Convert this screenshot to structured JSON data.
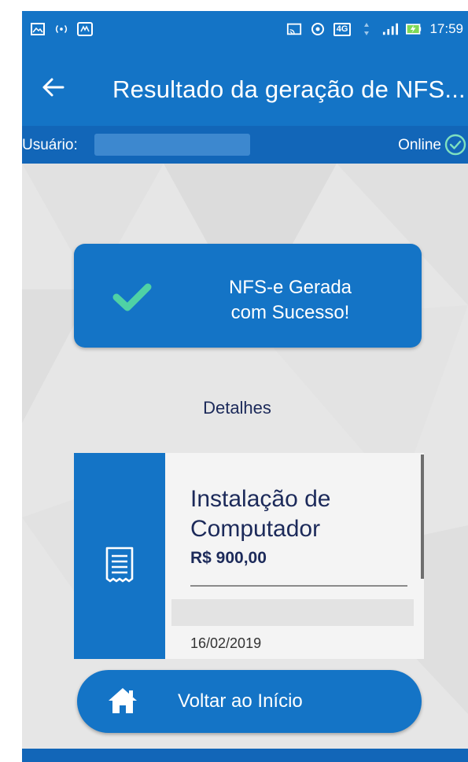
{
  "status_bar": {
    "left_icons": [
      "image-icon",
      "hotspot-icon",
      "app-icon"
    ],
    "right_icons": [
      "cast-icon",
      "nfc-icon",
      "network-4g-icon",
      "data-arrows-icon",
      "signal-icon",
      "battery-charging-icon"
    ],
    "network_label": "4G",
    "time": "17:59"
  },
  "app_bar": {
    "back_icon": "arrow-left-icon",
    "title": "Resultado da geração de NFS..."
  },
  "user_bar": {
    "user_label": "Usuário:",
    "status_text": "Online",
    "status_icon": "check-circle-icon"
  },
  "success": {
    "icon": "check-icon",
    "line1": "NFS-e Gerada",
    "line2": "com Sucesso!"
  },
  "details": {
    "heading": "Detalhes",
    "icon": "receipt-icon",
    "title_line1": "Instalação de",
    "title_line2": "Computador",
    "price": "R$ 900,00",
    "date": "16/02/2019"
  },
  "home_button": {
    "icon": "home-icon",
    "label": "Voltar ao Início"
  },
  "colors": {
    "primary": "#1474c6",
    "primary_dark": "#1266b8",
    "check_green": "#4fd1a5",
    "text_dark": "#1c2a5a",
    "background": "#e6e6e6"
  }
}
